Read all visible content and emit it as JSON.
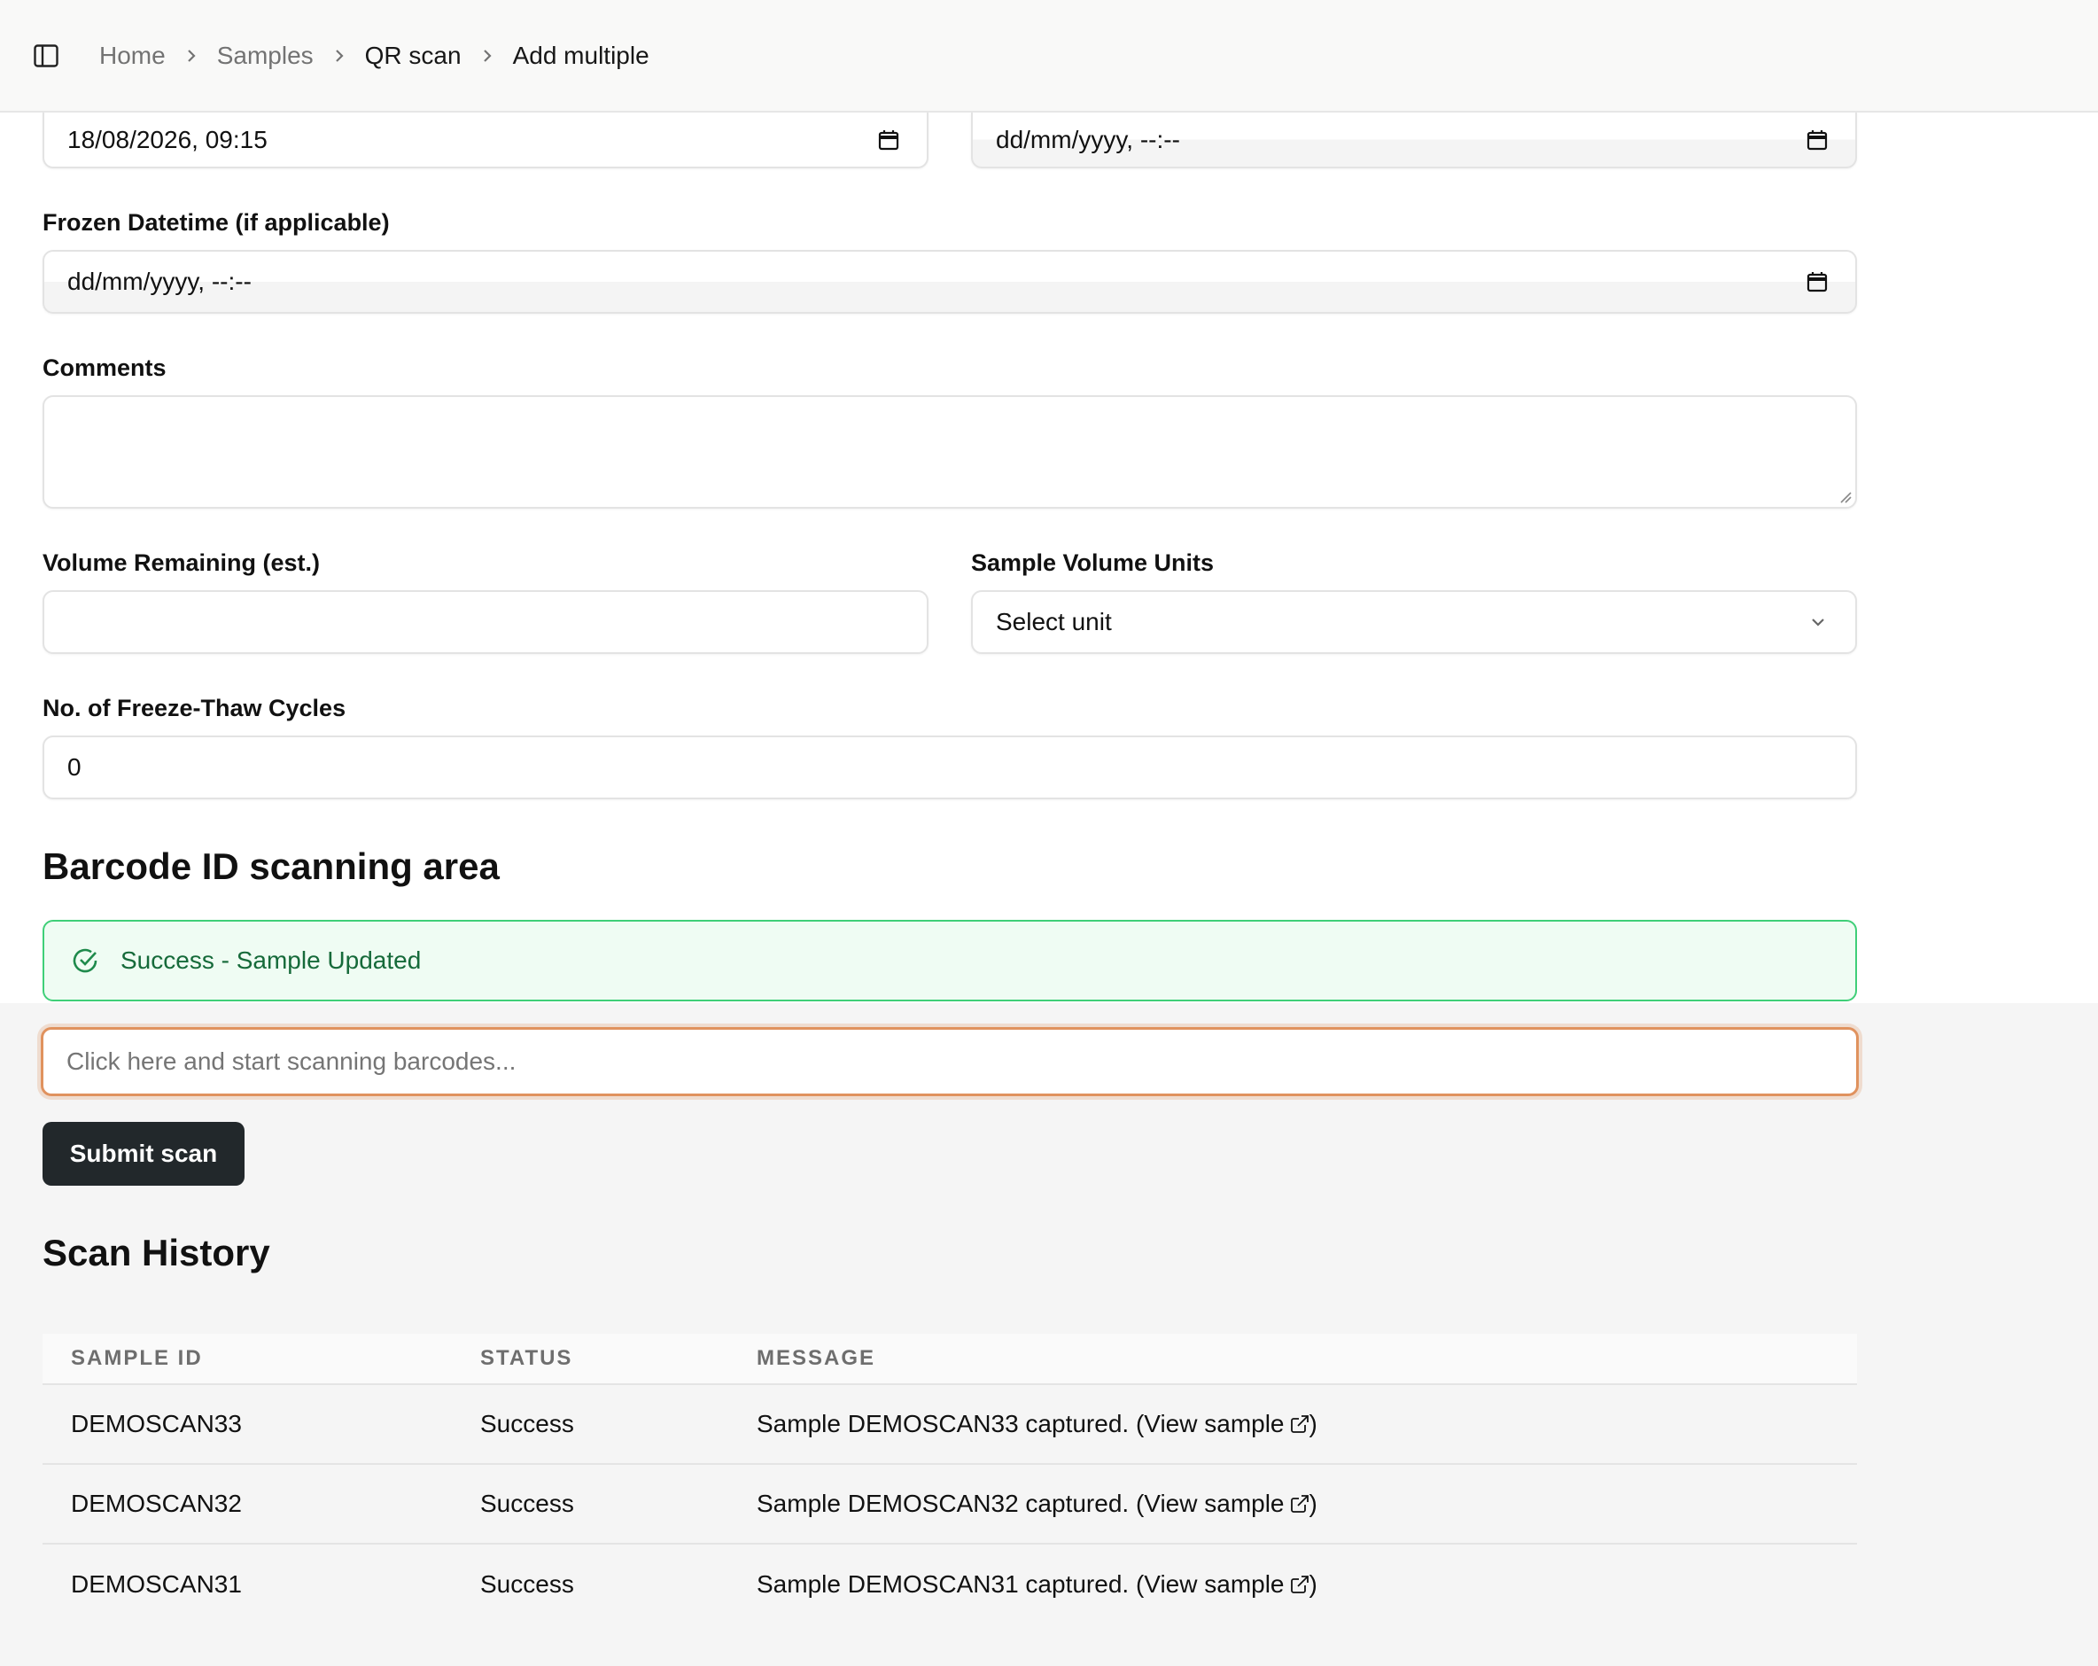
{
  "breadcrumb": {
    "items": [
      "Home",
      "Samples",
      "QR scan"
    ],
    "current": "Add multiple"
  },
  "form": {
    "datetime_1_value": "18/08/2026, 09:15",
    "datetime_2_value": "dd/mm/yyyy, --:--",
    "frozen": {
      "label": "Frozen Datetime (if applicable)",
      "value": "dd/mm/yyyy, --:--"
    },
    "comments": {
      "label": "Comments",
      "value": ""
    },
    "volume": {
      "label": "Volume Remaining (est.)",
      "value": ""
    },
    "units": {
      "label": "Sample Volume Units",
      "selected": "Select unit"
    },
    "freeze_thaw": {
      "label": "No. of Freeze-Thaw Cycles",
      "value": "0"
    }
  },
  "scanning": {
    "title": "Barcode ID scanning area",
    "alert": "Success - Sample Updated",
    "placeholder": "Click here and start scanning barcodes...",
    "submit_label": "Submit scan"
  },
  "history": {
    "title": "Scan History",
    "columns": [
      "SAMPLE ID",
      "STATUS",
      "MESSAGE"
    ],
    "rows": [
      {
        "id": "DEMOSCAN33",
        "status": "Success",
        "message": "Sample DEMOSCAN33 captured. (",
        "link": "View sample",
        "close": ")"
      },
      {
        "id": "DEMOSCAN32",
        "status": "Success",
        "message": "Sample DEMOSCAN32 captured. (",
        "link": "View sample",
        "close": ")"
      },
      {
        "id": "DEMOSCAN31",
        "status": "Success",
        "message": "Sample DEMOSCAN31 captured. (",
        "link": "View sample",
        "close": ")"
      }
    ]
  },
  "colors": {
    "success_border": "#3fcf78",
    "success_bg": "#effcf3",
    "focus_ring": "#e0925e",
    "button_bg": "#22282b"
  }
}
